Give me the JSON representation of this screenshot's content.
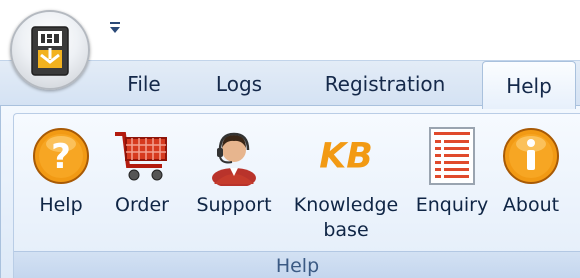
{
  "quick_access": {
    "dropdown_icon": "customize-quick-access-toolbar-arrow-icon"
  },
  "tabs": [
    {
      "label": "File",
      "active": false
    },
    {
      "label": "Logs",
      "active": false
    },
    {
      "label": "Registration",
      "active": false
    },
    {
      "label": "Help",
      "active": true
    }
  ],
  "ribbon": {
    "group_label": "Help",
    "buttons": [
      {
        "label": "Help",
        "icon": "help-question-icon"
      },
      {
        "label": "Order",
        "icon": "shopping-cart-icon"
      },
      {
        "label": "Support",
        "icon": "support-agent-icon"
      },
      {
        "label_line1": "Knowledge",
        "label_line2": "base",
        "icon": "knowledge-base-icon",
        "logo_text": "KB"
      },
      {
        "label": "Enquiry",
        "icon": "enquiry-document-icon"
      },
      {
        "label": "About",
        "icon": "info-icon"
      }
    ]
  },
  "colors": {
    "tab_text": "#15294a",
    "ribbon_bg": "#e7f0fb",
    "accent_orange": "#f29a14"
  }
}
